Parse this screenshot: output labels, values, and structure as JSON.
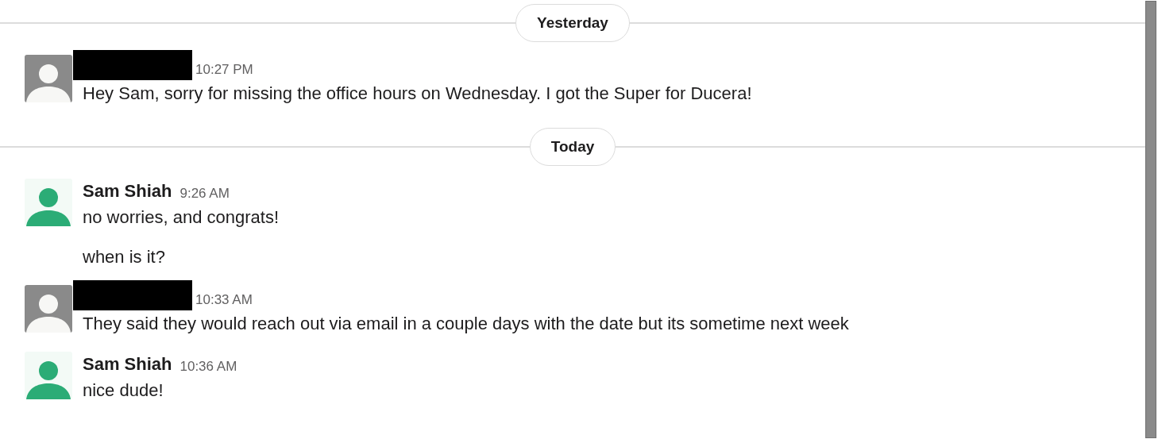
{
  "days": [
    {
      "label": "Yesterday",
      "groups": [
        {
          "author": {
            "redacted": true
          },
          "avatar": {
            "color": "#8a8a8a"
          },
          "time": "10:27 PM",
          "messages": [
            "Hey Sam, sorry for missing the office hours on Wednesday. I got the Super for Ducera!"
          ]
        }
      ]
    },
    {
      "label": "Today",
      "groups": [
        {
          "author": {
            "redacted": false,
            "name": "Sam Shiah"
          },
          "avatar": {
            "color": "#2bac76"
          },
          "time": "9:26 AM",
          "messages": [
            "no worries, and congrats!",
            "when is it?"
          ]
        },
        {
          "author": {
            "redacted": true
          },
          "avatar": {
            "color": "#8a8a8a"
          },
          "time": "10:33 AM",
          "messages": [
            "They said they would reach out via email in a couple days with the date but its sometime next week"
          ]
        },
        {
          "author": {
            "redacted": false,
            "name": "Sam Shiah"
          },
          "avatar": {
            "color": "#2bac76"
          },
          "time": "10:36 AM",
          "messages": [
            "nice dude!"
          ]
        }
      ]
    }
  ]
}
